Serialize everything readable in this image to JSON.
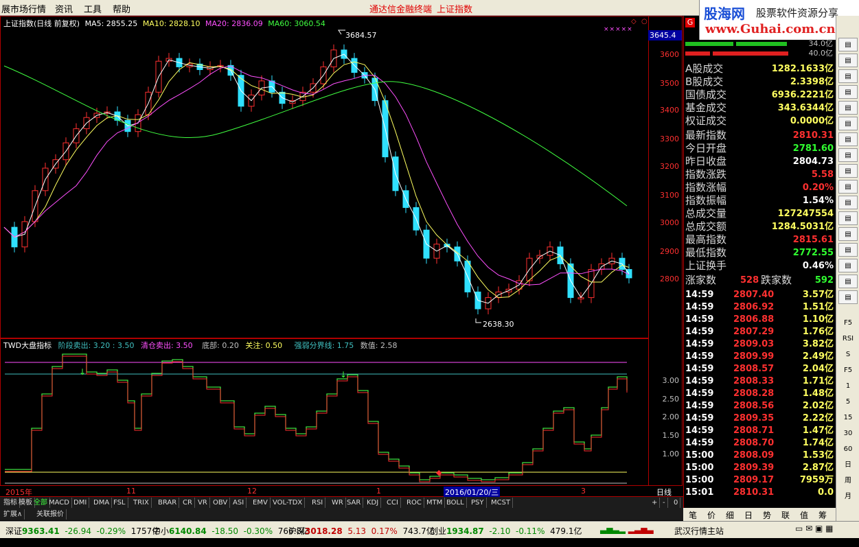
{
  "menubar": {
    "items": [
      "展市场行情",
      "资讯",
      "工具",
      "帮助"
    ],
    "terminal_title": "通达信金融终端",
    "security_title": "上证指数"
  },
  "banner": {
    "logo_text": "股海网",
    "tagline": "股票软件资源分享",
    "url": "www.Guhai.com.cn"
  },
  "main_chart": {
    "title": "上证指数(日线 前复权)",
    "ma": [
      {
        "label": "MA5: 2855.25",
        "color": "#ffffff"
      },
      {
        "label": "MA10: 2828.10",
        "color": "#ffff60"
      },
      {
        "label": "MA20: 2836.09",
        "color": "#ff50ff"
      },
      {
        "label": "MA60: 3060.54",
        "color": "#40ff40"
      }
    ],
    "high_label": "3684.57",
    "low_label": "2638.30",
    "price_tag": "3645.4",
    "y_ticks": [
      "3600",
      "3500",
      "3400",
      "3300",
      "3200",
      "3100",
      "3000",
      "2900",
      "2800"
    ]
  },
  "indicator": {
    "title": "TWD大盘指标",
    "params": [
      {
        "label": "阶段卖出: 3.20 : 3.50",
        "color": "#40c0c0"
      },
      {
        "label": "清仓卖出: 3.50",
        "color": "#ff50ff"
      },
      {
        "label": "底部: 0.20",
        "color": "#c0c0c0"
      },
      {
        "label": "关注: 0.50",
        "color": "#ffff60"
      },
      {
        "label": "强弱分界线: 1.75",
        "color": "#40c0c0"
      },
      {
        "label": "数值: 2.58",
        "color": "#c0c0c0"
      }
    ],
    "y_ticks": [
      "3.00",
      "2.50",
      "2.00",
      "1.50",
      "1.00"
    ],
    "axis_label": "日线"
  },
  "date_axis": {
    "labels": [
      "2015年",
      "11",
      "12",
      "1",
      "2016/01/20/三",
      "3"
    ]
  },
  "tabs": {
    "row1": [
      "指标",
      "模板",
      "全部",
      "MACD",
      "DMI",
      "DMA",
      "FSL",
      "TRIX",
      "BRAR",
      "CR",
      "VR",
      "OBV",
      "ASI",
      "EMV",
      "VOL-TDX",
      "RSI",
      "WR",
      "SAR",
      "KDJ",
      "CCI",
      "ROC",
      "MTM",
      "BOLL",
      "PSY",
      "MCST"
    ],
    "row2": [
      "扩展∧",
      "关联报价"
    ],
    "controls": [
      "+",
      "-",
      "0"
    ]
  },
  "right_panel": {
    "tag": "G",
    "bars": [
      {
        "label": "34.0亿"
      },
      {
        "label": "40.0亿"
      }
    ],
    "turnover": [
      {
        "label": "A股成交",
        "value": "1282.1633亿"
      },
      {
        "label": "B股成交",
        "value": "2.3398亿"
      },
      {
        "label": "国债成交",
        "value": "6936.2221亿"
      },
      {
        "label": "基金成交",
        "value": "343.6344亿"
      },
      {
        "label": "权证成交",
        "value": "0.0000亿"
      }
    ],
    "quote": [
      {
        "label": "最新指数",
        "value": "2810.31",
        "color": "#ff3030"
      },
      {
        "label": "今日开盘",
        "value": "2781.60",
        "color": "#30ff30"
      },
      {
        "label": "昨日收盘",
        "value": "2804.73",
        "color": "#ffffff"
      },
      {
        "label": "指数涨跌",
        "value": "5.58",
        "color": "#ff3030"
      },
      {
        "label": "指数涨幅",
        "value": "0.20%",
        "color": "#ff3030"
      },
      {
        "label": "指数振幅",
        "value": "1.54%",
        "color": "#ffffff"
      },
      {
        "label": "总成交量",
        "value": "127247554",
        "color": "#ffff60"
      },
      {
        "label": "总成交额",
        "value": "1284.5031亿",
        "color": "#ffff60"
      },
      {
        "label": "最高指数",
        "value": "2815.61",
        "color": "#ff3030"
      },
      {
        "label": "最低指数",
        "value": "2772.55",
        "color": "#30ff30"
      },
      {
        "label": "上证换手",
        "value": "0.46%",
        "color": "#ffffff"
      }
    ],
    "updown": {
      "up_label": "涨家数",
      "up_value": "528",
      "down_label": "跌家数",
      "down_value": "592"
    },
    "ticks": [
      {
        "time": "14:59",
        "price": "2807.40",
        "amount": "3.57亿"
      },
      {
        "time": "14:59",
        "price": "2806.92",
        "amount": "1.51亿"
      },
      {
        "time": "14:59",
        "price": "2806.88",
        "amount": "1.10亿"
      },
      {
        "time": "14:59",
        "price": "2807.29",
        "amount": "1.76亿"
      },
      {
        "time": "14:59",
        "price": "2809.03",
        "amount": "3.82亿"
      },
      {
        "time": "14:59",
        "price": "2809.99",
        "amount": "2.49亿"
      },
      {
        "time": "14:59",
        "price": "2808.57",
        "amount": "2.04亿"
      },
      {
        "time": "14:59",
        "price": "2808.33",
        "amount": "1.71亿"
      },
      {
        "time": "14:59",
        "price": "2808.28",
        "amount": "1.48亿"
      },
      {
        "time": "14:59",
        "price": "2808.56",
        "amount": "2.02亿"
      },
      {
        "time": "14:59",
        "price": "2809.35",
        "amount": "2.22亿"
      },
      {
        "time": "14:59",
        "price": "2808.71",
        "amount": "1.47亿"
      },
      {
        "time": "14:59",
        "price": "2808.70",
        "amount": "1.74亿"
      },
      {
        "time": "15:00",
        "price": "2808.09",
        "amount": "1.53亿"
      },
      {
        "time": "15:00",
        "price": "2809.39",
        "amount": "2.87亿"
      },
      {
        "time": "15:00",
        "price": "2809.17",
        "amount": "7959万"
      },
      {
        "time": "15:01",
        "price": "2810.31",
        "amount": "0.0"
      }
    ],
    "bottom_tabs": [
      "笔",
      "价",
      "细",
      "日",
      "势",
      "联",
      "值",
      "筹"
    ]
  },
  "toolbar_right": [
    "F5",
    "RSI",
    "S",
    "F5",
    "1",
    "5",
    "15",
    "30",
    "60",
    "日",
    "周",
    "月"
  ],
  "statusbar": {
    "items": [
      {
        "name": "深证",
        "index": "9363.41",
        "change": "-26.94",
        "pct": "-0.29%",
        "vol": "1757亿",
        "dir": "down"
      },
      {
        "name": "中小",
        "index": "6140.84",
        "change": "-18.50",
        "pct": "-0.30%",
        "vol": "766.8亿",
        "dir": "down"
      },
      {
        "name": "沪深",
        "index": "3018.28",
        "change": "5.13",
        "pct": "0.17%",
        "vol": "743.7亿",
        "dir": "up"
      },
      {
        "name": "创业",
        "index": "1934.87",
        "change": "-2.10",
        "pct": "-0.11%",
        "vol": "479.1亿",
        "dir": "down"
      }
    ],
    "server": "武汉行情主站"
  }
}
